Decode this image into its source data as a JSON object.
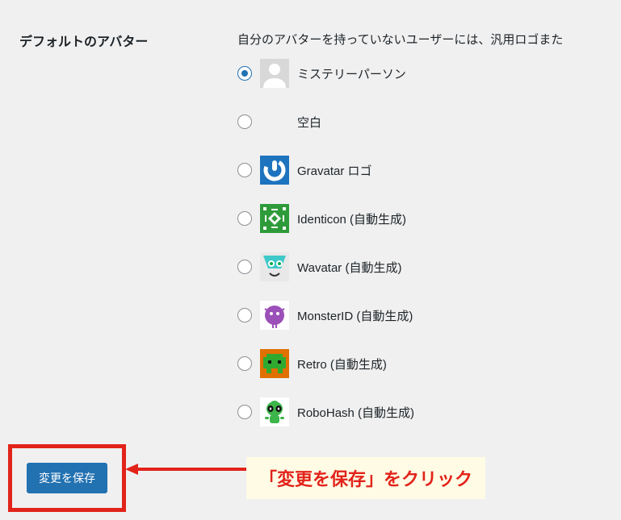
{
  "section": {
    "label": "デフォルトのアバター",
    "description": "自分のアバターを持っていないユーザーには、汎用ロゴまた"
  },
  "options": [
    {
      "id": "mystery",
      "label": "ミステリーパーソン",
      "checked": true
    },
    {
      "id": "blank",
      "label": "空白",
      "checked": false
    },
    {
      "id": "gravatar",
      "label": "Gravatar ロゴ",
      "checked": false
    },
    {
      "id": "identicon",
      "label": "Identicon (自動生成)",
      "checked": false
    },
    {
      "id": "wavatar",
      "label": "Wavatar (自動生成)",
      "checked": false
    },
    {
      "id": "monsterid",
      "label": "MonsterID (自動生成)",
      "checked": false
    },
    {
      "id": "retro",
      "label": "Retro (自動生成)",
      "checked": false
    },
    {
      "id": "robohash",
      "label": "RoboHash (自動生成)",
      "checked": false
    }
  ],
  "submit": {
    "button_label": "変更を保存"
  },
  "annotation": {
    "text": "「変更を保存」をクリック"
  },
  "colors": {
    "accent": "#2271b1",
    "danger": "#e2231a",
    "highlight_bg": "#fffbe5"
  }
}
